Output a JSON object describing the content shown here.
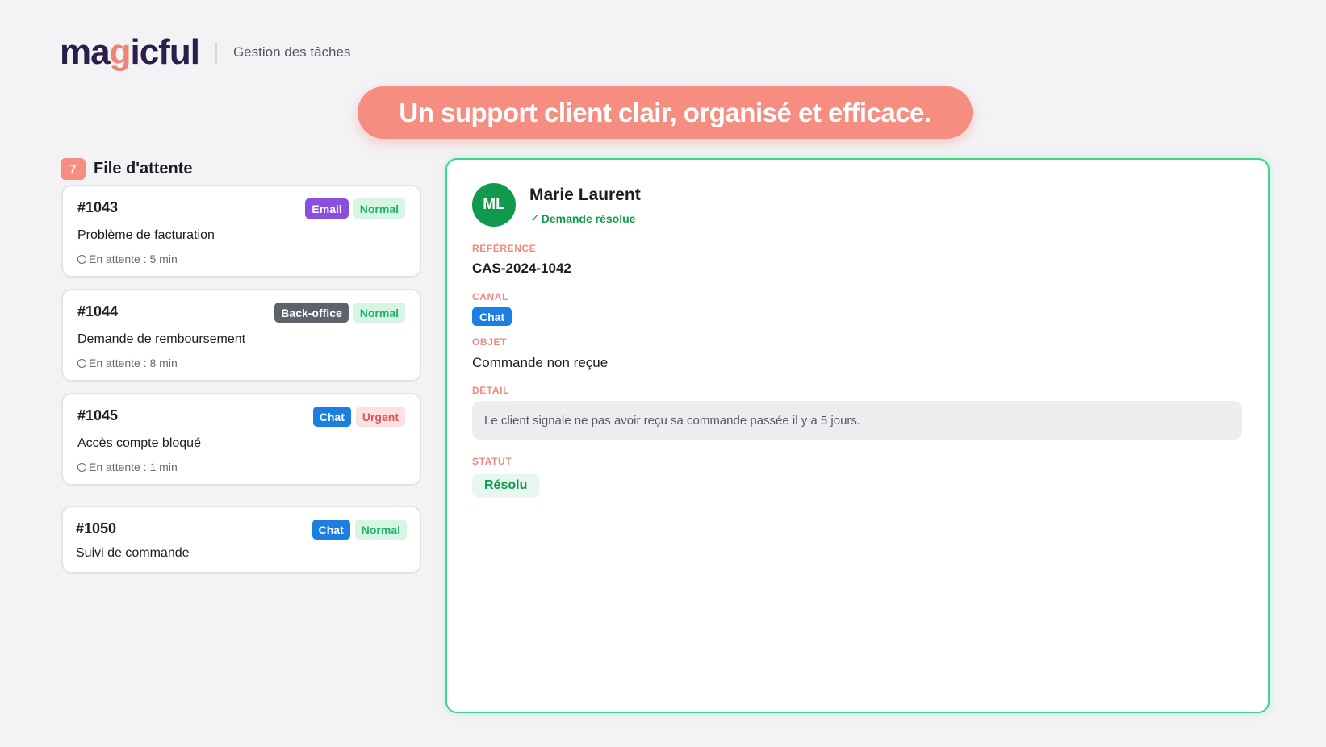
{
  "header": {
    "logo_text_start": "ma",
    "logo_text_g": "g",
    "logo_text_end": "icful",
    "subtitle": "Gestion des tâches"
  },
  "banner": {
    "text": "Un support client clair, organisé et efficace."
  },
  "queue": {
    "count": "7",
    "title": "File d'attente",
    "tickets": [
      {
        "id": "#1043",
        "channel": "Email",
        "priority": "Normal",
        "subject": "Problème de facturation",
        "wait": "En attente : 5 min"
      },
      {
        "id": "#1044",
        "channel": "Back-office",
        "priority": "Normal",
        "subject": "Demande de remboursement",
        "wait": "En attente : 8 min"
      },
      {
        "id": "#1045",
        "channel": "Chat",
        "priority": "Urgent",
        "subject": "Accès compte bloqué",
        "wait": "En attente : 1 min"
      },
      {
        "id": "#1050",
        "channel": "Chat",
        "priority": "Normal",
        "subject": "Suivi de commande",
        "wait": ""
      }
    ]
  },
  "detail": {
    "avatar_initials": "ML",
    "customer_name": "Marie Laurent",
    "resolved_check": "✓",
    "resolved_note": "Demande résolue",
    "reference_label": "RÉFÉRENCE",
    "reference_value": "CAS-2024-1042",
    "channel_label": "CANAL",
    "channel_value": "Chat",
    "subject_label": "OBJET",
    "subject_value": "Commande non reçue",
    "detail_label": "DÉTAIL",
    "detail_value": "Le client signale ne pas avoir reçu sa commande passée il y a 5 jours.",
    "status_label": "STATUT",
    "status_value": "Résolu"
  },
  "colors": {
    "accent_coral": "#f58d80",
    "success_green": "#109a4e",
    "panel_border": "#3fd58a",
    "email_tag": "#8b4fe0",
    "backoffice_tag": "#5f626c",
    "chat_tag": "#1a7fe0"
  },
  "icons": {
    "clock": "clock-icon",
    "check": "check-icon"
  }
}
